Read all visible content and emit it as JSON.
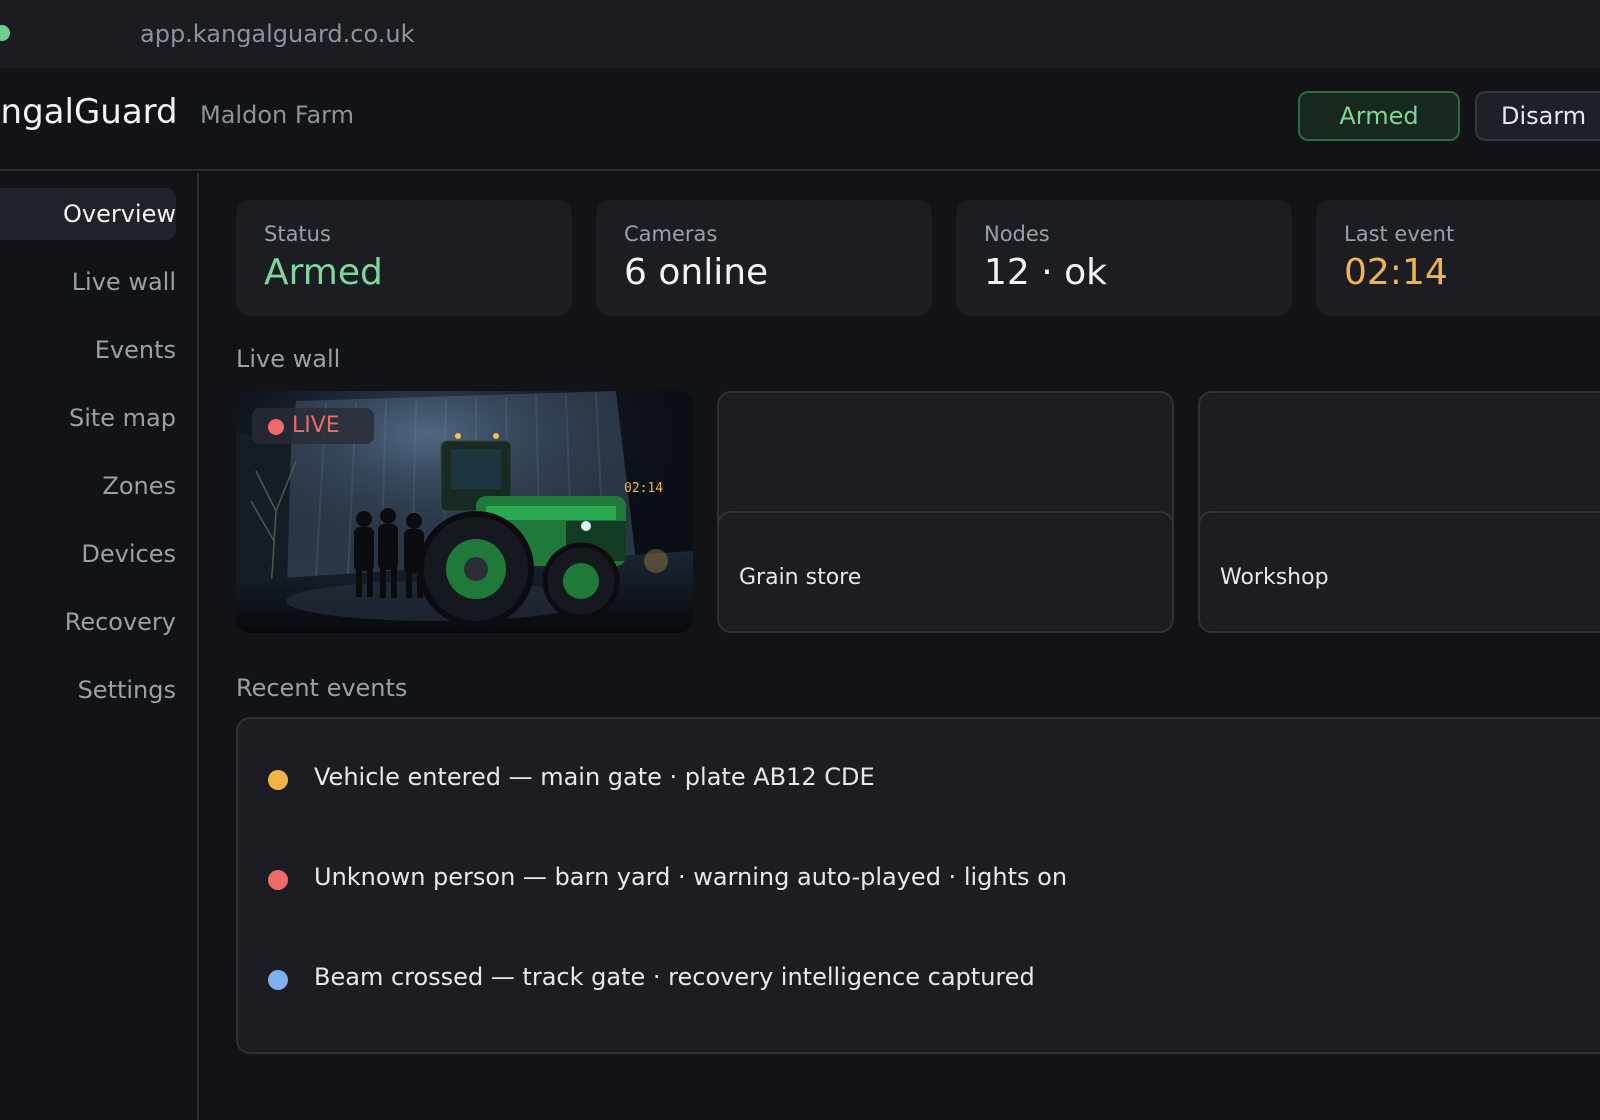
{
  "browser": {
    "url": "app.kangalguard.co.uk"
  },
  "header": {
    "brand": "KangalGuard",
    "site": "Maldon Farm",
    "armed_label": "Armed",
    "disarm_label": "Disarm"
  },
  "sidebar": {
    "items": [
      {
        "label": "Overview",
        "active": true
      },
      {
        "label": "Live wall"
      },
      {
        "label": "Events"
      },
      {
        "label": "Site map"
      },
      {
        "label": "Zones"
      },
      {
        "label": "Devices"
      },
      {
        "label": "Recovery"
      },
      {
        "label": "Settings"
      }
    ]
  },
  "stats": [
    {
      "label": "Status",
      "value": "Armed",
      "tone": "green"
    },
    {
      "label": "Cameras",
      "value": "6 online",
      "tone": "default"
    },
    {
      "label": "Nodes",
      "value": "12 · ok",
      "tone": "default"
    },
    {
      "label": "Last event",
      "value": "02:14",
      "tone": "amber"
    }
  ],
  "live_wall": {
    "title": "Live wall",
    "live_badge": "LIVE",
    "feed_timestamp": "02:14",
    "tiles": [
      {
        "caption": "Grain store"
      },
      {
        "caption": "Workshop"
      }
    ]
  },
  "recent_events": {
    "title": "Recent events",
    "items": [
      {
        "text": "Vehicle entered — main gate · plate AB12 CDE",
        "color": "#f2b44a"
      },
      {
        "text": "Unknown person — barn yard · warning auto-played · lights on",
        "color": "#f06a6a"
      },
      {
        "text": "Beam crossed — track gate · recovery intelligence captured",
        "color": "#7fb0f0"
      }
    ]
  },
  "colors": {
    "accent_green": "#7fd69a",
    "accent_amber": "#f2b44a",
    "alert_red": "#f06a6a",
    "info_blue": "#7fb0f0"
  }
}
